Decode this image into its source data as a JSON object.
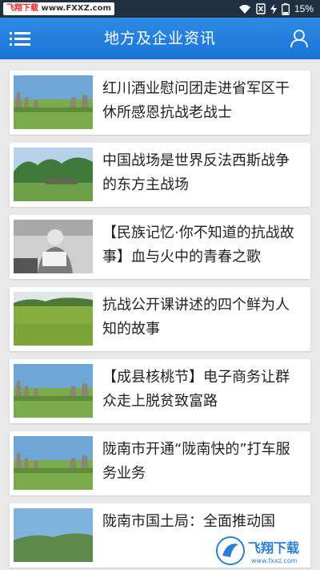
{
  "status_bar": {
    "site_badge": {
      "part1": "飞翔下载",
      "part2": " www.FXXZ.com"
    },
    "battery": "15%"
  },
  "header": {
    "title": "地方及企业资讯",
    "menu_icon": "menu-icon",
    "user_icon": "user-icon"
  },
  "articles": [
    {
      "title": "红川酒业慰问团走进省军区干休所感恩抗战老战士",
      "thumb": "stone-forest"
    },
    {
      "title": "中国战场是世界反法西斯战争的东方主战场",
      "thumb": "garden"
    },
    {
      "title": "【民族记忆·你不知道的抗战故事】血与火中的青春之歌",
      "thumb": "elder-bw"
    },
    {
      "title": "抗战公开课讲述的四个鲜为人知的故事",
      "thumb": "meadow"
    },
    {
      "title": "【成县核桃节】电子商务让群众走上脱贫致富路",
      "thumb": "stone-forest"
    },
    {
      "title": "陇南市开通“陇南快的”打车服务业务",
      "thumb": "stone-forest"
    },
    {
      "title": "陇南市国土局：全面推动国",
      "thumb": "sky"
    }
  ],
  "watermark": {
    "text": "飞翔下载",
    "url": "www.fxxz.com"
  },
  "colors": {
    "appbar": "#1f7ddc",
    "statusbar": "#1f3140",
    "background": "#e9e9e9"
  }
}
